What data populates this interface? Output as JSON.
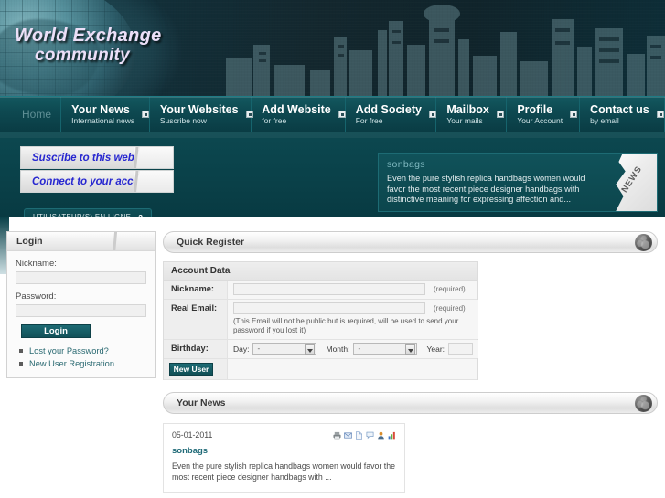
{
  "brand": {
    "line1": "World Exchange",
    "line2": "community"
  },
  "nav": {
    "home_label": "Home",
    "items": [
      {
        "title": "Your News",
        "sub": "International news",
        "icon": "square-dot-icon"
      },
      {
        "title": "Your Websites",
        "sub": "Suscribe now",
        "icon": "square-dot-icon"
      },
      {
        "title": "Add Website",
        "sub": "for free",
        "icon": "square-dot-icon"
      },
      {
        "title": "Add Society",
        "sub": "For free",
        "icon": "square-dot-icon"
      },
      {
        "title": "Mailbox",
        "sub": "Your mails",
        "icon": "square-dot-icon"
      },
      {
        "title": "Profile",
        "sub": "Your Account",
        "icon": "square-dot-icon"
      },
      {
        "title": "Contact us",
        "sub": "by email",
        "icon": "square-dot-icon"
      }
    ]
  },
  "hero": {
    "subscribe_button": "Suscribe to this website",
    "connect_button": "Connect to your account",
    "news_teaser": {
      "ribbon": "NEWS",
      "title": "sonbags",
      "body": "Even the pure stylish replica handbags women would favor the most recent piece designer handbags with distinctive meaning for expressing affection and..."
    }
  },
  "online": {
    "label": "UTILISATEUR(S) EN LIGNE",
    "count": "2"
  },
  "sidebar": {
    "login": {
      "title": "Login",
      "nickname_label": "Nickname:",
      "nickname_value": "",
      "password_label": "Password:",
      "password_value": "",
      "submit_label": "Login",
      "links": [
        {
          "label": "Lost your Password?"
        },
        {
          "label": "New User Registration"
        }
      ]
    }
  },
  "main": {
    "quick_register": {
      "panel_title": "Quick Register",
      "panel_icon": "globe-icon",
      "section_title": "Account Data",
      "rows": [
        {
          "label": "Nickname:",
          "value": "",
          "required": "(required)"
        },
        {
          "label": "Real Email:",
          "value": "",
          "required": "(required)",
          "note": "(This Email will not be public but is required, will be used to send your password if you lost it)"
        }
      ],
      "birthday": {
        "label": "Birthday:",
        "day_label": "Day:",
        "day_value": "-",
        "month_label": "Month:",
        "month_value": "-",
        "year_label": "Year:",
        "year_value": ""
      },
      "submit_label": "New User"
    },
    "your_news": {
      "panel_title": "Your News",
      "panel_icon": "globe-icon",
      "items": [
        {
          "date": "05-01-2011",
          "title": "sonbags",
          "body": "Even the pure stylish replica handbags women would favor the most recent piece designer handbags with ...",
          "icons": [
            "printer-icon",
            "email-icon",
            "document-icon",
            "comment-icon",
            "user-icon",
            "chart-icon"
          ]
        }
      ]
    }
  },
  "colors": {
    "banner_dark": "#13272e",
    "nav_teal": "#0e4a52",
    "band_teal": "#0a4149",
    "accent_blue": "#2727d0",
    "link_teal": "#1f6a77",
    "button_teal": "#1d6a73"
  }
}
